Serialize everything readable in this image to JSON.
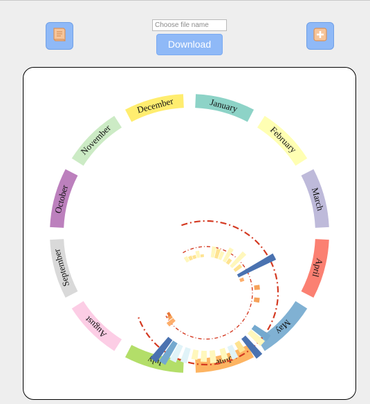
{
  "toolbar": {
    "book_icon": "book-icon",
    "add_icon": "plus-icon",
    "filename_placeholder": "Choose file name",
    "download_label": "Download",
    "accent_color": "#8fb9f7",
    "icon_color": "#f6c59a"
  },
  "chart_data": {
    "type": "radial",
    "months": [
      {
        "label": "January",
        "color": "#8dd3c7"
      },
      {
        "label": "February",
        "color": "#ffffb3"
      },
      {
        "label": "March",
        "color": "#bebada"
      },
      {
        "label": "April",
        "color": "#fb8072"
      },
      {
        "label": "May",
        "color": "#80b1d3"
      },
      {
        "label": "June",
        "color": "#fdb462"
      },
      {
        "label": "July",
        "color": "#b3de69"
      },
      {
        "label": "August",
        "color": "#fccde5"
      },
      {
        "label": "September",
        "color": "#d9d9d9"
      },
      {
        "label": "October",
        "color": "#bc80bd"
      },
      {
        "label": "November",
        "color": "#ccebc5"
      },
      {
        "label": "December",
        "color": "#ffed6f"
      }
    ]
  }
}
